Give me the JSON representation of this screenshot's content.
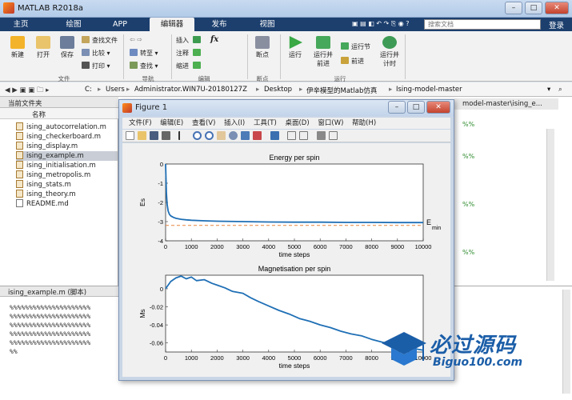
{
  "app": {
    "title": "MATLAB R2018a"
  },
  "tabs": [
    {
      "label": "主页"
    },
    {
      "label": "绘图"
    },
    {
      "label": "APP"
    },
    {
      "label": "编辑器"
    },
    {
      "label": "发布"
    },
    {
      "label": "视图"
    }
  ],
  "search": {
    "placeholder": "搜索文档"
  },
  "login_label": "登录",
  "ribbon": {
    "file": {
      "new": "新建",
      "open": "打开",
      "save": "保存",
      "find_files": "查找文件",
      "compare": "比较",
      "print": "打印",
      "section": "文件"
    },
    "navigate": {
      "goto": "转至",
      "find": "查找",
      "section": "导航"
    },
    "edit": {
      "insert": "插入",
      "comment": "注释",
      "indent": "缩进",
      "fx": "fx",
      "section": "编辑"
    },
    "breakpoints": {
      "label": "断点",
      "section": "断点"
    },
    "run": {
      "run": "运行",
      "run_advance": "运行并\n前进",
      "run_section": "运行节",
      "advance": "前进",
      "run_time": "运行并\n计时",
      "section": "运行"
    }
  },
  "address": {
    "parts": [
      "C:",
      "Users",
      "Administrator.WIN7U-20180127Z",
      "Desktop",
      "伊辛模型的Matlab仿真",
      "Ising-model-master"
    ]
  },
  "left_panel": {
    "title": "当前文件夹",
    "col_header": "名称",
    "files": [
      "ising_autocorrelation.m",
      "ising_checkerboard.m",
      "ising_display.m",
      "ising_example.m",
      "ising_initialisation.m",
      "ising_metropolis.m",
      "ising_stats.m",
      "ising_theory.m",
      "README.md"
    ],
    "selected_index": 3
  },
  "details_panel": {
    "title": "ising_example.m  (脚本)",
    "lines": [
      "%%%%%%%%%%%%%%%%%%%%%",
      "%%%%%%%%%%%%%%%%%%%%%",
      "%%%%%%%%%%%%%%%%%%%%%",
      "%%%%%%%%%%%%%%%%%%%%%",
      "%%%%%%%%%%%%%%%%%%%%%",
      "%%"
    ]
  },
  "editor": {
    "path_fragment": "model-master\\ising_e...",
    "pct_marks": [
      "%%",
      "%%",
      "%%",
      "%%"
    ]
  },
  "figure": {
    "title": "Figure 1",
    "menu": [
      "文件(F)",
      "编辑(E)",
      "查看(V)",
      "插入(I)",
      "工具(T)",
      "桌面(D)",
      "窗口(W)",
      "帮助(H)"
    ]
  },
  "chart_data": [
    {
      "type": "line",
      "title": "Energy per spin",
      "xlabel": "time steps",
      "ylabel": "Es",
      "xlim": [
        0,
        10000
      ],
      "ylim": [
        -4,
        0
      ],
      "xticks": [
        0,
        1000,
        2000,
        3000,
        4000,
        5000,
        6000,
        7000,
        8000,
        9000,
        10000
      ],
      "yticks": [
        -4,
        -3,
        -2,
        -1,
        0
      ],
      "series": [
        {
          "x": [
            0,
            30,
            60,
            100,
            150,
            200,
            300,
            400,
            600,
            800,
            1000,
            1500,
            2000,
            3000,
            4000,
            5000,
            6000,
            7000,
            8000,
            9000,
            10000
          ],
          "y": [
            0,
            -1.5,
            -2.1,
            -2.45,
            -2.62,
            -2.7,
            -2.78,
            -2.83,
            -2.88,
            -2.91,
            -2.93,
            -2.96,
            -2.98,
            -3.0,
            -3.02,
            -3.03,
            -3.03,
            -3.04,
            -3.04,
            -3.05,
            -3.05
          ]
        }
      ],
      "reference_line": {
        "label_main": "E",
        "label_sub": "min",
        "y": -3.2
      }
    },
    {
      "type": "line",
      "title": "Magnetisation per spin",
      "xlabel": "time steps",
      "ylabel": "Ms",
      "xlim": [
        0,
        10000
      ],
      "ylim": [
        -0.07,
        0.015
      ],
      "xticks": [
        0,
        1000,
        2000,
        3000,
        4000,
        5000,
        6000,
        7000,
        8000,
        9000,
        10000
      ],
      "yticks": [
        0,
        -0.02,
        -0.04,
        -0.06
      ],
      "series": [
        {
          "x": [
            0,
            200,
            400,
            600,
            800,
            1000,
            1200,
            1500,
            1800,
            2000,
            2300,
            2600,
            3000,
            3300,
            3600,
            4000,
            4400,
            4800,
            5200,
            5600,
            6000,
            6400,
            6800,
            7200,
            7600,
            8000,
            8400,
            8800,
            9200,
            9600,
            10000
          ],
          "y": [
            0,
            0.008,
            0.012,
            0.014,
            0.011,
            0.013,
            0.009,
            0.01,
            0.006,
            0.004,
            0.001,
            -0.003,
            -0.005,
            -0.01,
            -0.014,
            -0.019,
            -0.024,
            -0.028,
            -0.033,
            -0.036,
            -0.04,
            -0.043,
            -0.047,
            -0.05,
            -0.052,
            -0.056,
            -0.059,
            -0.062,
            -0.064,
            -0.066,
            -0.068
          ]
        }
      ]
    }
  ],
  "watermark": {
    "main": "必过源码",
    "sub": "Biguo100.com"
  },
  "colors": {
    "series": "#1f6fb5",
    "ref": "#e8843c",
    "ribbon_tab": "#1c3f6e"
  }
}
